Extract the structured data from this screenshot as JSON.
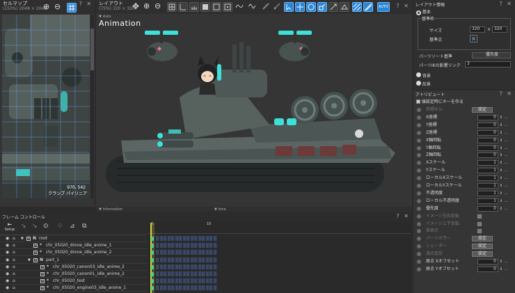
{
  "cellmap": {
    "title": "セルマップ",
    "sub": "(150%) 2048 × 2048",
    "coord": "970, 542",
    "label": "クランプ パイリニア"
  },
  "layout": {
    "title": "レイアウト",
    "sub": "(75%) 320 × 320",
    "overlay": "Animation",
    "tab_stats": "stats",
    "tab_information": "information",
    "tab_time": "time"
  },
  "layout_info": {
    "title": "レイアウト情報",
    "basic": "基本",
    "group": "基準枠",
    "size_label": "サイズ",
    "size_w": "320",
    "size_x": "×",
    "size_h": "320",
    "origin_label": "基準点",
    "sort_label": "パーツソート基準",
    "sort_value": "優先度",
    "ik_label": "パーツIKの影響リンク",
    "ik_value": "3",
    "bg": "背景",
    "fg": "前景"
  },
  "attribute": {
    "title": "アトリビュート",
    "option": "値設定時にキーを作る",
    "set_label": "設定",
    "rows": [
      {
        "label": "参照セル",
        "kind": "button",
        "value": "設定"
      },
      {
        "label": "X座標",
        "kind": "number",
        "value": "0"
      },
      {
        "label": "Y座標",
        "kind": "number",
        "value": "0"
      },
      {
        "label": "Z座標",
        "kind": "number",
        "value": "0"
      },
      {
        "label": "X軸回転",
        "kind": "number",
        "value": "0"
      },
      {
        "label": "Y軸回転",
        "kind": "number",
        "value": "0"
      },
      {
        "label": "Z軸回転",
        "kind": "number",
        "value": "0"
      },
      {
        "label": "Xスケール",
        "kind": "number",
        "value": "1"
      },
      {
        "label": "Yスケール",
        "kind": "number",
        "value": "1"
      },
      {
        "label": "ローカルXスケール",
        "kind": "number",
        "value": "1"
      },
      {
        "label": "ローカルYスケール",
        "kind": "number",
        "value": "1"
      },
      {
        "label": "不透明度",
        "kind": "number",
        "value": "1"
      },
      {
        "label": "ローカル不透明度",
        "kind": "number",
        "value": "1"
      },
      {
        "label": "優先度",
        "kind": "number",
        "value": "0"
      },
      {
        "label": "イメージ左右反転",
        "kind": "check",
        "value": ""
      },
      {
        "label": "イメージ上下反転",
        "kind": "check",
        "value": ""
      },
      {
        "label": "非表示",
        "kind": "check",
        "value": ""
      },
      {
        "label": "パーツカラー",
        "kind": "button",
        "value": "設定"
      },
      {
        "label": "シェーダー",
        "kind": "button",
        "value": "設定"
      },
      {
        "label": "頂点変形",
        "kind": "button",
        "value": "設定"
      },
      {
        "label": "原点 Xオフセット",
        "kind": "number",
        "value": "0"
      },
      {
        "label": "原点 Yオフセット",
        "kind": "number",
        "value": "0"
      }
    ]
  },
  "frame_control": {
    "title": "フレーム コントロール",
    "setup": "Setup",
    "tick_0": "0",
    "tick_10": "10",
    "tree": [
      {
        "indent": 0,
        "arrow": "▼",
        "type": "N",
        "name": "root"
      },
      {
        "indent": 1,
        "arrow": "",
        "type": "*",
        "name": "chr_05020_drone_idle_anime_1"
      },
      {
        "indent": 1,
        "arrow": "",
        "type": "*",
        "name": "chr_05020_drone_idle_anime_2"
      },
      {
        "indent": 1,
        "arrow": "▼",
        "type": "N",
        "name": "part_1"
      },
      {
        "indent": 2,
        "arrow": "",
        "type": "*",
        "name": "chr_05020_canon03_idle_anime_2"
      },
      {
        "indent": 2,
        "arrow": "",
        "type": "*",
        "name": "chr_05020_canon01_idle_anime_2"
      },
      {
        "indent": 2,
        "arrow": "",
        "type": "*",
        "name": "chr_05020_test"
      },
      {
        "indent": 2,
        "arrow": "",
        "type": "*",
        "name": "chr_05020_engine03_idle_anime_1"
      }
    ]
  },
  "colors": {
    "accent": "#2a86d6",
    "teal": "#3fe0d8",
    "panel": "#353535"
  }
}
